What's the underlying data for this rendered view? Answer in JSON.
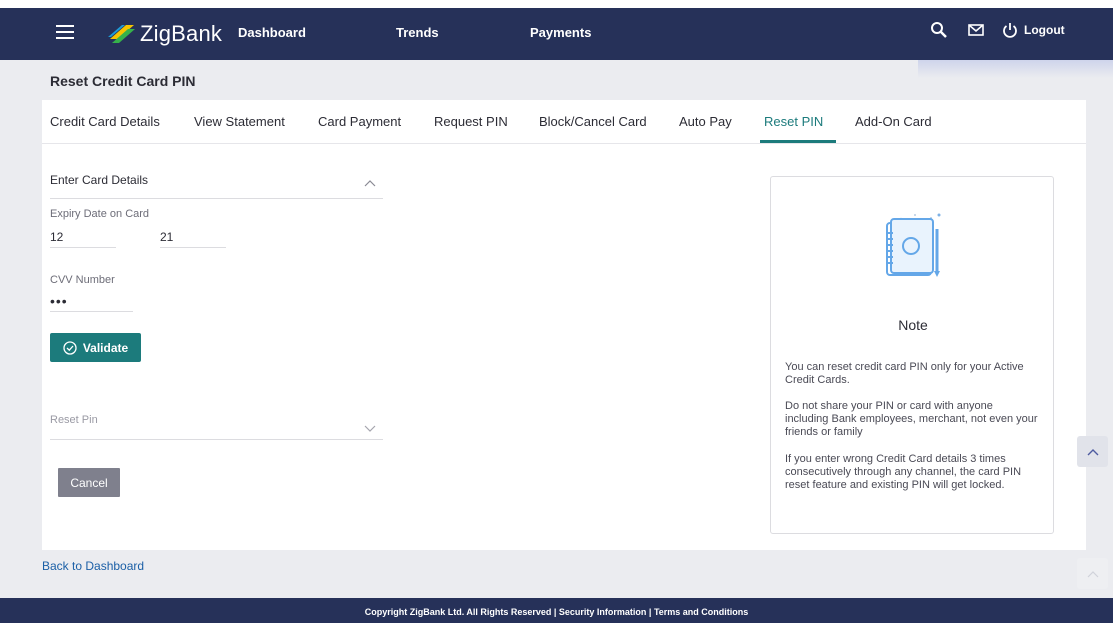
{
  "app": {
    "brand": "ZigBank",
    "page_title": "Reset Credit Card PIN"
  },
  "nav": {
    "links": [
      "Dashboard",
      "Trends",
      "Payments"
    ],
    "logout_label": "Logout",
    "icons": [
      "menu-icon",
      "search-icon",
      "mail-icon",
      "power-icon"
    ]
  },
  "tabs": [
    {
      "label": "Credit Card Details",
      "active": false
    },
    {
      "label": "View Statement",
      "active": false
    },
    {
      "label": "Card Payment",
      "active": false
    },
    {
      "label": "Request PIN",
      "active": false
    },
    {
      "label": "Block/Cancel Card",
      "active": false
    },
    {
      "label": "Auto Pay",
      "active": false
    },
    {
      "label": "Reset PIN",
      "active": true
    },
    {
      "label": "Add-On Card",
      "active": false
    }
  ],
  "form": {
    "card_details_header": "Enter Card Details",
    "expiry_label": "Expiry Date on Card",
    "expiry_month": "12",
    "expiry_year": "21",
    "cvv_label": "CVV Number",
    "cvv_value": "•••",
    "validate_label": "Validate",
    "reset_pin_header": "Reset Pin",
    "cancel_label": "Cancel"
  },
  "note": {
    "title": "Note",
    "paragraphs": [
      "You can reset credit card PIN only for your Active Credit Cards.",
      "Do not share your PIN or card with anyone including Bank employees, merchant, not even your friends or family",
      "If you enter wrong Credit Card details 3 times consecutively through any channel, the card PIN reset feature and existing PIN will get locked."
    ]
  },
  "links": {
    "back": "Back to Dashboard"
  },
  "footer": {
    "text": "Copyright ZigBank Ltd. All Rights Reserved | Security Information | Terms and Conditions"
  },
  "colors": {
    "navbar": "#263159",
    "accent": "#1c7b7c",
    "cancel": "#7f808d",
    "link": "#1b5fa6"
  }
}
